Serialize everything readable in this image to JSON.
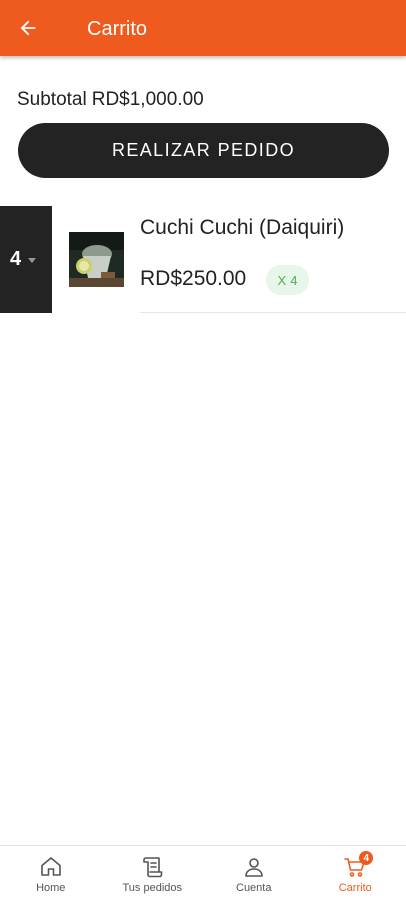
{
  "appbar": {
    "title": "Carrito",
    "back_icon": "arrow-left-icon",
    "color": "#ef5a1f"
  },
  "summary": {
    "subtotal_label": "Subtotal",
    "subtotal_value": "RD$1,000.00"
  },
  "order_button": {
    "label": "REALIZAR PEDIDO"
  },
  "cart_items": [
    {
      "quantity_select": "4",
      "name": "Cuchi Cuchi (Daiquiri)",
      "price": "RD$250.00",
      "chip_prefix": "X",
      "chip_count": "4"
    }
  ],
  "bottom_nav": {
    "items": [
      {
        "label": "Home",
        "icon": "home-icon"
      },
      {
        "label": "Tus pedidos",
        "icon": "receipt-icon"
      },
      {
        "label": "Cuenta",
        "icon": "user-icon"
      },
      {
        "label": "Carrito",
        "icon": "cart-icon",
        "badge": "4",
        "active": true
      }
    ]
  }
}
